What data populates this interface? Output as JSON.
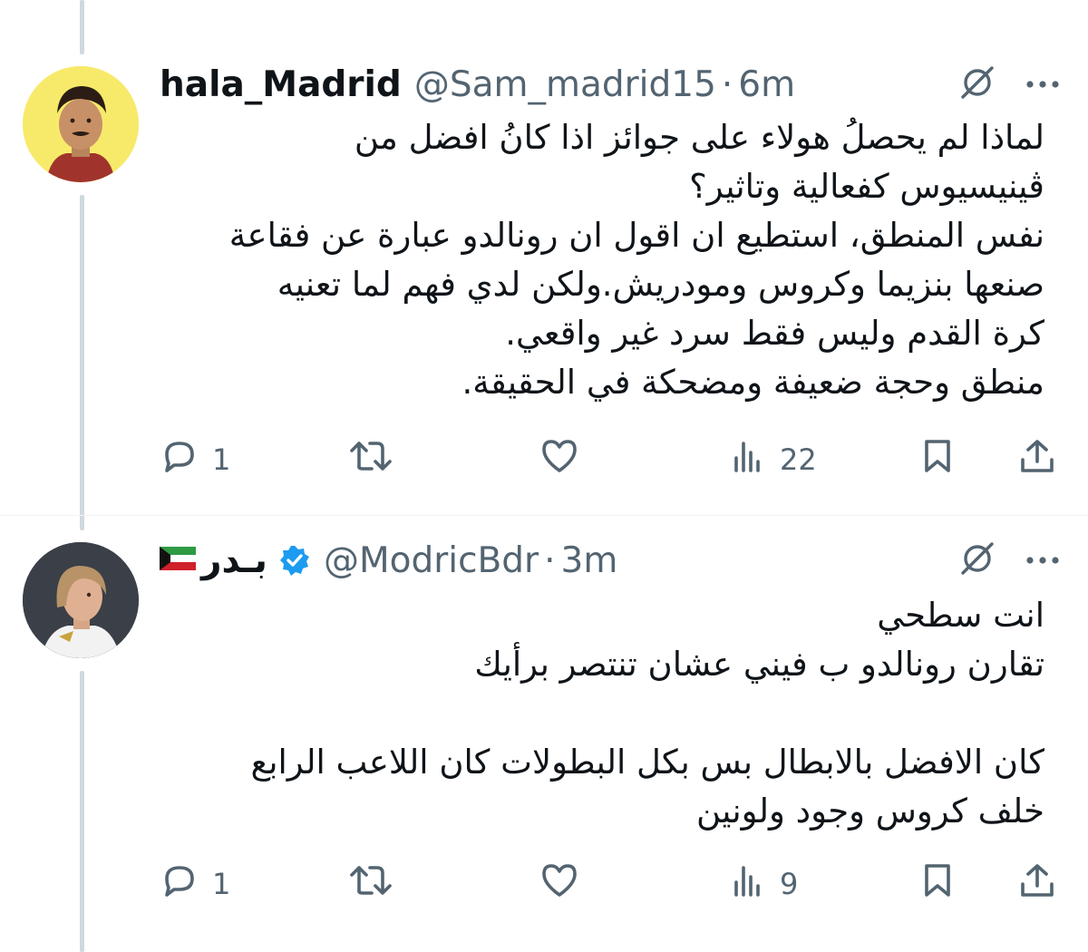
{
  "tweets": [
    {
      "display_name": "hala_Madrid",
      "handle": "@Sam_madrid15",
      "separator": "·",
      "time": "6m",
      "lines": [
        "لماذا لم يحصلُ هولاء على جوائز اذا كانُ افضل من",
        "ڤينيسيوس كفعالية وتاثير؟",
        "نفس المنطق، استطيع ان اقول ان رونالدو عبارة عن فقاعة",
        "صنعها بنزيما وكروس ومودريش.ولكن لدي فهم لما تعنيه",
        "كرة القدم وليس فقط سرد غير واقعي.",
        "منطق وحجة ضعيفة ومضحكة في الحقيقة."
      ],
      "replies": "1",
      "retweets": "",
      "likes": "",
      "views": "22",
      "avatar_bg": "#f7ea6a"
    },
    {
      "display_name": "بـدر",
      "handle": "@ModricBdr",
      "separator": "·",
      "time": "3m",
      "verified": true,
      "lines": [
        "انت سطحي",
        "تقارن رونالدو ب فيني عشان تنتصر برأيك",
        "",
        "كان الافضل بالابطال بس بكل البطولات كان اللاعب الرابع",
        "خلف كروس وجود ولونين"
      ],
      "replies": "1",
      "retweets": "",
      "likes": "",
      "views": "9",
      "avatar_bg": "#3a3f48"
    }
  ],
  "icons": {
    "grok": "grok-icon",
    "more": "more-icon",
    "reply": "reply-icon",
    "retweet": "retweet-icon",
    "like": "like-icon",
    "views": "views-icon",
    "bookmark": "bookmark-icon",
    "share": "share-icon",
    "verified": "verified-badge-icon"
  },
  "colors": {
    "text": "#0f1419",
    "secondary": "#536471",
    "verified": "#1d9bf0",
    "thread_line": "#cfd9de"
  }
}
